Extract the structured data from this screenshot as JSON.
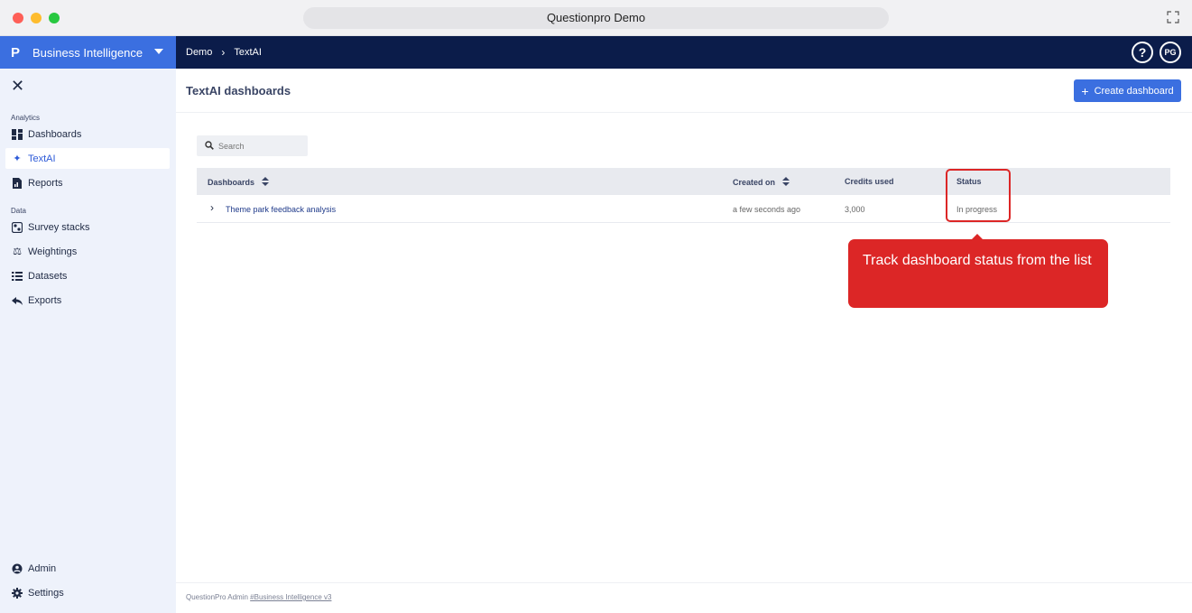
{
  "window": {
    "title": "Questionpro Demo"
  },
  "topbar": {
    "brand_logo": "P",
    "brand_name": "Business Intelligence",
    "breadcrumb": [
      "Demo",
      "TextAI"
    ],
    "help_label": "?",
    "avatar_initials": "PG"
  },
  "sidebar": {
    "analytics_label": "Analytics",
    "data_label": "Data",
    "items": {
      "dashboards": "Dashboards",
      "textai": "TextAI",
      "reports": "Reports",
      "survey_stacks": "Survey stacks",
      "weightings": "Weightings",
      "datasets": "Datasets",
      "exports": "Exports",
      "admin": "Admin",
      "settings": "Settings"
    }
  },
  "main": {
    "title": "TextAI dashboards",
    "create_label": "Create dashboard",
    "search_placeholder": "Search",
    "table": {
      "headers": [
        "Dashboards",
        "Created on",
        "Credits used",
        "Status"
      ],
      "rows": [
        {
          "name": "Theme park feedback analysis",
          "created": "a few seconds ago",
          "credits": "3,000",
          "status": "In progress"
        }
      ]
    }
  },
  "callout": {
    "text": "Track dashboard status from the list"
  },
  "footer": {
    "prefix": "QuestionPro Admin",
    "link": "#Business Intelligence v3"
  },
  "colors": {
    "brand": "#3b6fe0",
    "nav": "#0b1c4a",
    "callout": "#dc2626"
  }
}
